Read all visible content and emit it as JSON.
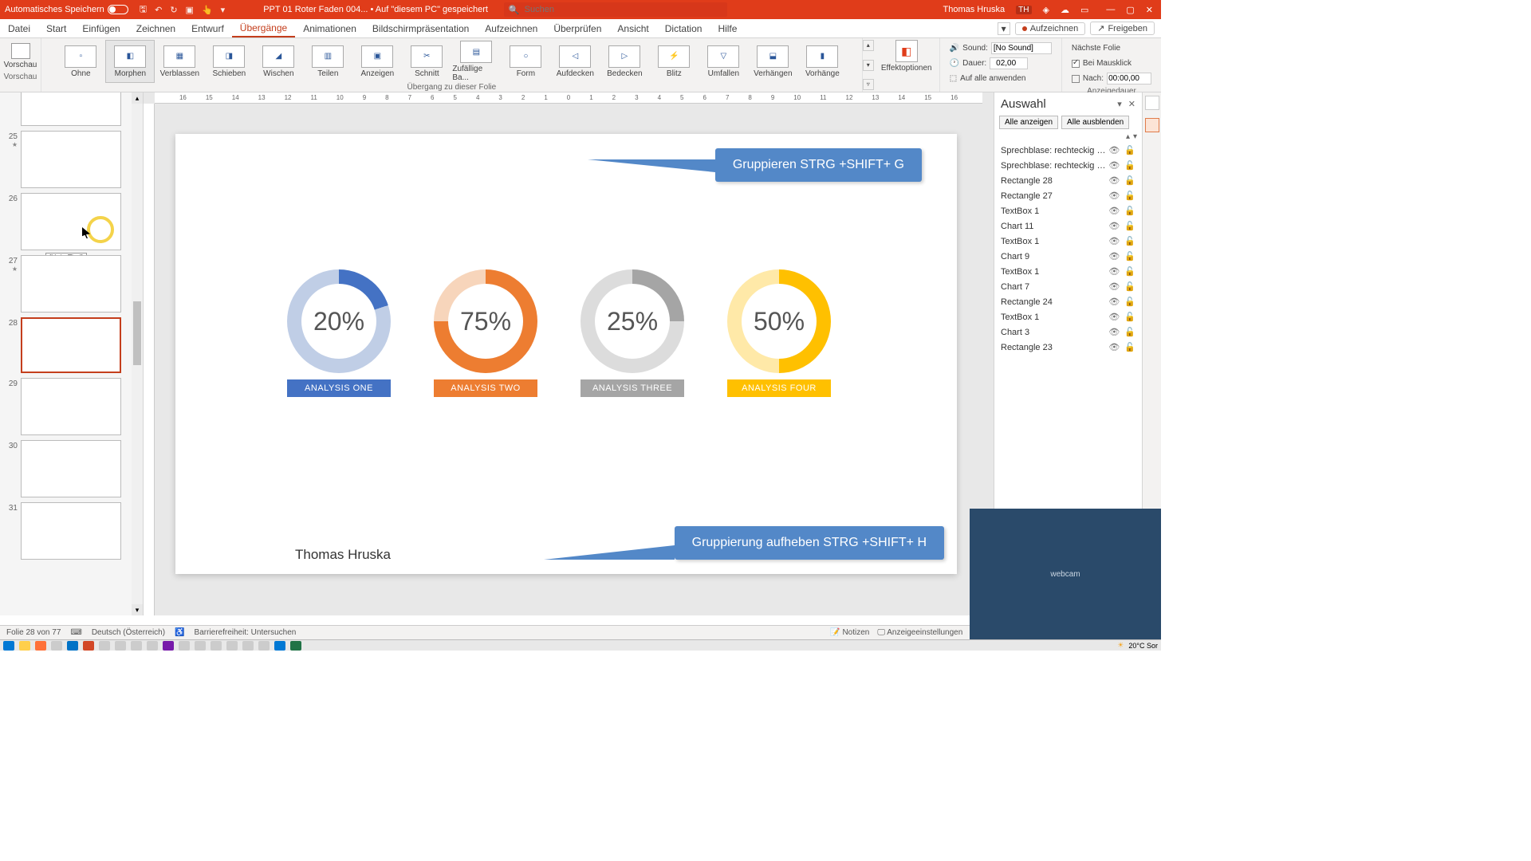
{
  "titlebar": {
    "autosave": "Automatisches Speichern",
    "doc": "PPT 01 Roter Faden 004... • Auf \"diesem PC\" gespeichert",
    "search_ph": "Suchen",
    "user": "Thomas Hruska",
    "badge": "TH"
  },
  "tabs": {
    "list": [
      "Datei",
      "Start",
      "Einfügen",
      "Zeichnen",
      "Entwurf",
      "Übergänge",
      "Animationen",
      "Bildschirmpräsentation",
      "Aufzeichnen",
      "Überprüfen",
      "Ansicht",
      "Dictation",
      "Hilfe"
    ],
    "active": 5,
    "record": "Aufzeichnen",
    "share": "Freigeben"
  },
  "ribbon": {
    "preview": "Vorschau",
    "transitions": [
      "Ohne",
      "Morphen",
      "Verblassen",
      "Schieben",
      "Wischen",
      "Teilen",
      "Anzeigen",
      "Schnitt",
      "Zufällige Ba...",
      "Form",
      "Aufdecken",
      "Bedecken",
      "Blitz",
      "Umfallen",
      "Verhängen",
      "Vorhänge"
    ],
    "selected": 1,
    "group1": "Übergang zu dieser Folie",
    "effekt": "Effektoptionen",
    "sound_l": "Sound:",
    "sound_v": "[No Sound]",
    "dauer_l": "Dauer:",
    "dauer_v": "02,00",
    "applyall": "Auf alle anwenden",
    "next": "Nächste Folie",
    "onclick": "Bei Mausklick",
    "after_l": "Nach:",
    "after_v": "00:00,00",
    "group2": "Anzeigedauer"
  },
  "thumbs": [
    {
      "n": "",
      "star": ""
    },
    {
      "n": "25",
      "star": "★"
    },
    {
      "n": "26",
      "star": ""
    },
    {
      "n": "27",
      "star": "★"
    },
    {
      "n": "28",
      "star": ""
    },
    {
      "n": "29",
      "star": ""
    },
    {
      "n": "30",
      "star": ""
    },
    {
      "n": "31",
      "star": ""
    }
  ],
  "thumb_tooltip": "[Kein Titel]",
  "slide": {
    "co1": "Gruppieren  STRG +SHIFT+ G",
    "co2": "Gruppierung aufheben  STRG +SHIFT+ H",
    "author": "Thomas Hruska",
    "donuts": [
      {
        "pct": "20%",
        "label": "ANALYSIS ONE",
        "col": "#4472c4",
        "light": "#c0cee6"
      },
      {
        "pct": "75%",
        "label": "ANALYSIS TWO",
        "col": "#ed7d31",
        "light": "#f7d5bb"
      },
      {
        "pct": "25%",
        "label": "ANALYSIS THREE",
        "col": "#a5a5a5",
        "light": "#dcdcdc"
      },
      {
        "pct": "50%",
        "label": "ANALYSIS FOUR",
        "col": "#ffc000",
        "light": "#ffe9a8"
      }
    ]
  },
  "chart_data": [
    {
      "type": "pie",
      "title": "ANALYSIS ONE",
      "values": [
        20,
        80
      ],
      "colors": [
        "#4472c4",
        "#c0cee6"
      ]
    },
    {
      "type": "pie",
      "title": "ANALYSIS TWO",
      "values": [
        75,
        25
      ],
      "colors": [
        "#ed7d31",
        "#f7d5bb"
      ]
    },
    {
      "type": "pie",
      "title": "ANALYSIS THREE",
      "values": [
        25,
        75
      ],
      "colors": [
        "#a5a5a5",
        "#dcdcdc"
      ]
    },
    {
      "type": "pie",
      "title": "ANALYSIS FOUR",
      "values": [
        50,
        50
      ],
      "colors": [
        "#ffc000",
        "#ffe9a8"
      ]
    }
  ],
  "selection": {
    "title": "Auswahl",
    "showall": "Alle anzeigen",
    "hideall": "Alle ausblenden",
    "items": [
      "Sprechblase: rechteckig m...",
      "Sprechblase: rechteckig m...",
      "Rectangle 28",
      "Rectangle 27",
      "TextBox 1",
      "Chart 11",
      "TextBox 1",
      "Chart 9",
      "TextBox 1",
      "Chart 7",
      "Rectangle 24",
      "TextBox 1",
      "Chart 3",
      "Rectangle 23"
    ]
  },
  "status": {
    "slide": "Folie 28 von 77",
    "lang": "Deutsch (Österreich)",
    "access": "Barrierefreiheit: Untersuchen",
    "notes": "Notizen",
    "display": "Anzeigeeinstellungen",
    "fit": "⛶"
  },
  "taskbar": {
    "weather": "20°C  Sor"
  }
}
